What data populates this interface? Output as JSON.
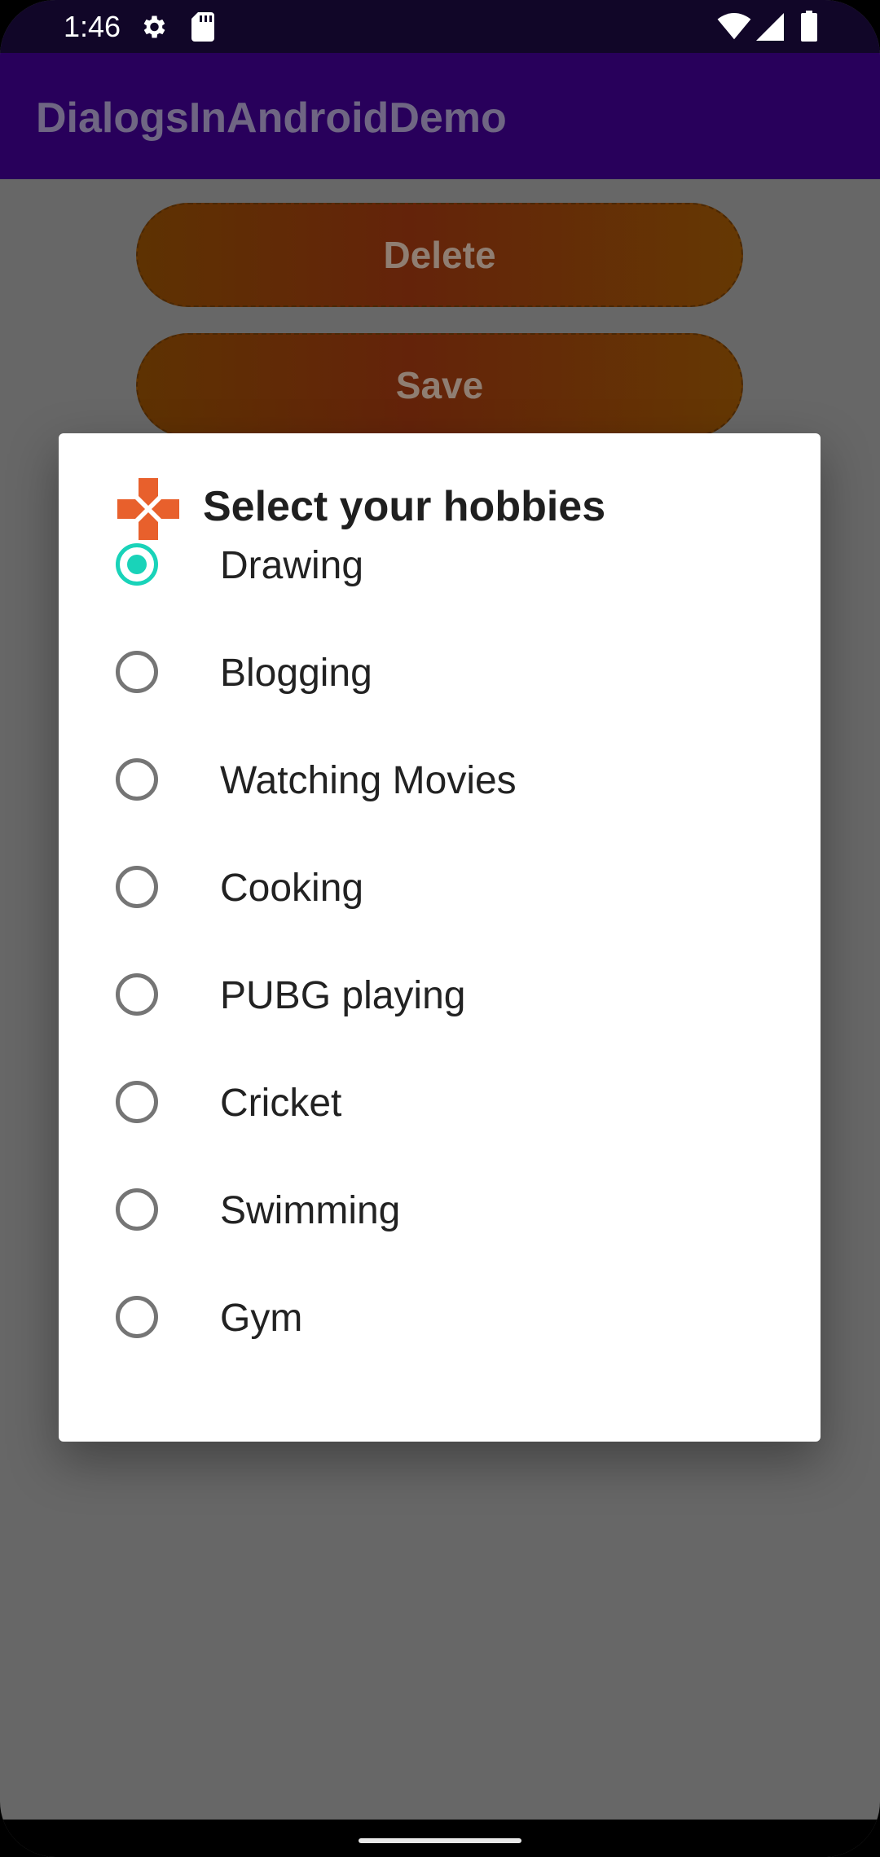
{
  "status_bar": {
    "time": "1:46",
    "icons": [
      "gear-icon",
      "sd-card-icon",
      "wifi-icon",
      "signal-icon",
      "battery-icon"
    ]
  },
  "app_bar": {
    "title": "DialogsInAndroidDemo"
  },
  "background_buttons": {
    "delete_label": "Delete",
    "save_label": "Save"
  },
  "dialog": {
    "icon": "plus-cross-icon",
    "icon_color": "#e8602c",
    "title": "Select your hobbies",
    "selected_index": 0,
    "accent_color": "#19d3b9",
    "options": [
      {
        "label": "Drawing",
        "checked": true
      },
      {
        "label": "Blogging",
        "checked": false
      },
      {
        "label": "Watching Movies",
        "checked": false
      },
      {
        "label": "Cooking",
        "checked": false
      },
      {
        "label": "PUBG playing",
        "checked": false
      },
      {
        "label": "Cricket",
        "checked": false
      },
      {
        "label": "Swimming",
        "checked": false
      },
      {
        "label": "Gym",
        "checked": false
      }
    ]
  },
  "colors": {
    "status_bar": "#110628",
    "app_bar": "#28005b",
    "scrim_background": "#676767"
  }
}
